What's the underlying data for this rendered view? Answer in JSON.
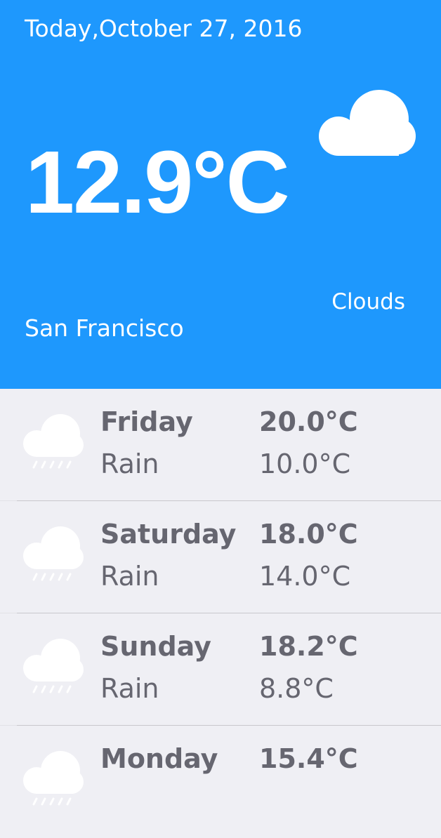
{
  "today": {
    "date_text": "Today,October 27, 2016",
    "temperature": "12.9°C",
    "condition": "Clouds",
    "city": "San Francisco",
    "icon": "cloud-icon"
  },
  "forecast": [
    {
      "day": "Friday",
      "condition": "Rain",
      "high": "20.0°C",
      "low": "10.0°C",
      "icon": "rain-cloud-icon"
    },
    {
      "day": "Saturday",
      "condition": "Rain",
      "high": "18.0°C",
      "low": "14.0°C",
      "icon": "rain-cloud-icon"
    },
    {
      "day": "Sunday",
      "condition": "Rain",
      "high": "18.2°C",
      "low": "8.8°C",
      "icon": "rain-cloud-icon"
    },
    {
      "day": "Monday",
      "condition": "",
      "high": "15.4°C",
      "low": "",
      "icon": "rain-cloud-icon"
    }
  ],
  "colors": {
    "header_background": "#1e98fd",
    "list_background": "#efeff4",
    "list_text": "#666670"
  }
}
